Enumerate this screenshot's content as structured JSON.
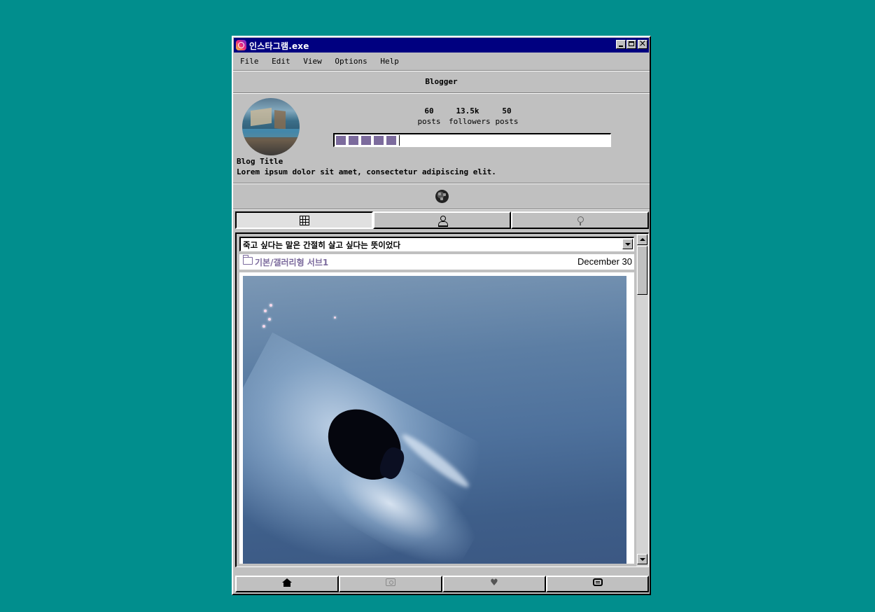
{
  "window": {
    "title": "인스타그램.exe"
  },
  "menu": [
    {
      "label": "File"
    },
    {
      "label": "Edit"
    },
    {
      "label": "View"
    },
    {
      "label": "Options"
    },
    {
      "label": "Help"
    }
  ],
  "profile": {
    "section_title": "Blogger",
    "stats": [
      {
        "value": "60",
        "label": "posts"
      },
      {
        "value": "13.5k",
        "label": "followers"
      },
      {
        "value": "50",
        "label": "posts"
      }
    ],
    "progress_fraction": 0.28,
    "progress_color": "#7c6b9d",
    "blog_title": "Blog Title",
    "blog_description": "Lorem ipsum dolor sit amet, consectetur adipiscing elit."
  },
  "tabs": [
    {
      "icon": "grid-icon",
      "active": true
    },
    {
      "icon": "user-icon",
      "active": false
    },
    {
      "icon": "pin-icon",
      "active": false
    }
  ],
  "post": {
    "selected_title": "죽고 싶다는 말은 간절히 살고 싶다는 뜻이었다",
    "category": "기본/갤러리형 서브1",
    "date": "December 30",
    "category_color": "#7c6b9d"
  },
  "bottom_nav": [
    {
      "icon": "home-icon"
    },
    {
      "icon": "tv-icon"
    },
    {
      "icon": "heart-icon"
    },
    {
      "icon": "chat-icon"
    }
  ],
  "colors": {
    "desktop": "#018e8d",
    "titlebar": "#000080",
    "window": "#c0c0c0",
    "accent": "#7c6b9d"
  }
}
